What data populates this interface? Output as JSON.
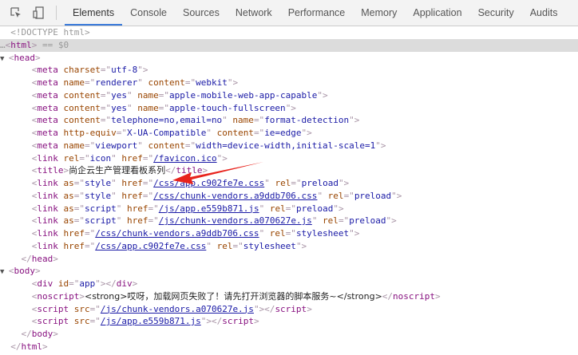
{
  "toolbar": {
    "icons": [
      "inspect-element-icon",
      "device-toggle-icon"
    ],
    "tabs": [
      {
        "label": "Elements",
        "active": true
      },
      {
        "label": "Console"
      },
      {
        "label": "Sources"
      },
      {
        "label": "Network"
      },
      {
        "label": "Performance"
      },
      {
        "label": "Memory"
      },
      {
        "label": "Application"
      },
      {
        "label": "Security"
      },
      {
        "label": "Audits"
      }
    ]
  },
  "colors": {
    "accent": "#3879d9",
    "arrow": "#e8231d",
    "tag": "#881280",
    "attr": "#994500",
    "value": "#1a1aa6"
  },
  "lines": [
    {
      "indent": 1,
      "t": [
        [
          "dim",
          "<!DOCTYPE html>"
        ]
      ]
    },
    {
      "indent": 0,
      "sel": true,
      "t": [
        [
          "dim",
          "…"
        ],
        [
          "br",
          "<"
        ],
        [
          "tag",
          "html"
        ],
        [
          "br",
          ">"
        ],
        [
          "dim",
          " == $0"
        ]
      ]
    },
    {
      "indent": 1,
      "tri": "▼",
      "t": [
        [
          "br",
          "<"
        ],
        [
          "tag",
          "head"
        ],
        [
          "br",
          ">"
        ]
      ]
    },
    {
      "indent": 3,
      "t": [
        [
          "br",
          "<"
        ],
        [
          "tag",
          "meta"
        ],
        [
          "attr",
          " charset"
        ],
        [
          "br",
          "=\""
        ],
        [
          "val",
          "utf-8"
        ],
        [
          "br",
          "\">"
        ]
      ]
    },
    {
      "indent": 3,
      "t": [
        [
          "br",
          "<"
        ],
        [
          "tag",
          "meta"
        ],
        [
          "attr",
          " name"
        ],
        [
          "br",
          "=\""
        ],
        [
          "val",
          "renderer"
        ],
        [
          "br",
          "\""
        ],
        [
          "attr",
          " content"
        ],
        [
          "br",
          "=\""
        ],
        [
          "val",
          "webkit"
        ],
        [
          "br",
          "\">"
        ]
      ]
    },
    {
      "indent": 3,
      "t": [
        [
          "br",
          "<"
        ],
        [
          "tag",
          "meta"
        ],
        [
          "attr",
          " content"
        ],
        [
          "br",
          "=\""
        ],
        [
          "val",
          "yes"
        ],
        [
          "br",
          "\""
        ],
        [
          "attr",
          " name"
        ],
        [
          "br",
          "=\""
        ],
        [
          "val",
          "apple-mobile-web-app-capable"
        ],
        [
          "br",
          "\">"
        ]
      ]
    },
    {
      "indent": 3,
      "t": [
        [
          "br",
          "<"
        ],
        [
          "tag",
          "meta"
        ],
        [
          "attr",
          " content"
        ],
        [
          "br",
          "=\""
        ],
        [
          "val",
          "yes"
        ],
        [
          "br",
          "\""
        ],
        [
          "attr",
          " name"
        ],
        [
          "br",
          "=\""
        ],
        [
          "val",
          "apple-touch-fullscreen"
        ],
        [
          "br",
          "\">"
        ]
      ]
    },
    {
      "indent": 3,
      "t": [
        [
          "br",
          "<"
        ],
        [
          "tag",
          "meta"
        ],
        [
          "attr",
          " content"
        ],
        [
          "br",
          "=\""
        ],
        [
          "val",
          "telephone=no,email=no"
        ],
        [
          "br",
          "\""
        ],
        [
          "attr",
          " name"
        ],
        [
          "br",
          "=\""
        ],
        [
          "val",
          "format-detection"
        ],
        [
          "br",
          "\">"
        ]
      ]
    },
    {
      "indent": 3,
      "t": [
        [
          "br",
          "<"
        ],
        [
          "tag",
          "meta"
        ],
        [
          "attr",
          " http-equiv"
        ],
        [
          "br",
          "=\""
        ],
        [
          "val",
          "X-UA-Compatible"
        ],
        [
          "br",
          "\""
        ],
        [
          "attr",
          " content"
        ],
        [
          "br",
          "=\""
        ],
        [
          "val",
          "ie=edge"
        ],
        [
          "br",
          "\">"
        ]
      ]
    },
    {
      "indent": 3,
      "t": [
        [
          "br",
          "<"
        ],
        [
          "tag",
          "meta"
        ],
        [
          "attr",
          " name"
        ],
        [
          "br",
          "=\""
        ],
        [
          "val",
          "viewport"
        ],
        [
          "br",
          "\""
        ],
        [
          "attr",
          " content"
        ],
        [
          "br",
          "=\""
        ],
        [
          "val",
          "width=device-width,initial-scale=1"
        ],
        [
          "br",
          "\">"
        ]
      ]
    },
    {
      "indent": 3,
      "t": [
        [
          "br",
          "<"
        ],
        [
          "tag",
          "link"
        ],
        [
          "attr",
          " rel"
        ],
        [
          "br",
          "=\""
        ],
        [
          "val",
          "icon"
        ],
        [
          "br",
          "\""
        ],
        [
          "attr",
          " href"
        ],
        [
          "br",
          "=\""
        ],
        [
          "link",
          "/favicon.ico"
        ],
        [
          "br",
          "\">"
        ]
      ]
    },
    {
      "indent": 3,
      "t": [
        [
          "br",
          "<"
        ],
        [
          "tag",
          "title"
        ],
        [
          "br",
          ">"
        ],
        [
          "txt",
          "尚企云生产管理看板系列"
        ],
        [
          "br",
          "</"
        ],
        [
          "tag",
          "title"
        ],
        [
          "br",
          ">"
        ]
      ]
    },
    {
      "indent": 3,
      "t": [
        [
          "br",
          "<"
        ],
        [
          "tag",
          "link"
        ],
        [
          "attr",
          " as"
        ],
        [
          "br",
          "=\""
        ],
        [
          "val",
          "style"
        ],
        [
          "br",
          "\""
        ],
        [
          "attr",
          " href"
        ],
        [
          "br",
          "=\""
        ],
        [
          "link",
          "/css/app.c902fe7e.css"
        ],
        [
          "br",
          "\""
        ],
        [
          "attr",
          " rel"
        ],
        [
          "br",
          "=\""
        ],
        [
          "val",
          "preload"
        ],
        [
          "br",
          "\">"
        ]
      ]
    },
    {
      "indent": 3,
      "t": [
        [
          "br",
          "<"
        ],
        [
          "tag",
          "link"
        ],
        [
          "attr",
          " as"
        ],
        [
          "br",
          "=\""
        ],
        [
          "val",
          "style"
        ],
        [
          "br",
          "\""
        ],
        [
          "attr",
          " href"
        ],
        [
          "br",
          "=\""
        ],
        [
          "link",
          "/css/chunk-vendors.a9ddb706.css"
        ],
        [
          "br",
          "\""
        ],
        [
          "attr",
          " rel"
        ],
        [
          "br",
          "=\""
        ],
        [
          "val",
          "preload"
        ],
        [
          "br",
          "\">"
        ]
      ]
    },
    {
      "indent": 3,
      "t": [
        [
          "br",
          "<"
        ],
        [
          "tag",
          "link"
        ],
        [
          "attr",
          " as"
        ],
        [
          "br",
          "=\""
        ],
        [
          "val",
          "script"
        ],
        [
          "br",
          "\""
        ],
        [
          "attr",
          " href"
        ],
        [
          "br",
          "=\""
        ],
        [
          "link",
          "/js/app.e559b871.js"
        ],
        [
          "br",
          "\""
        ],
        [
          "attr",
          " rel"
        ],
        [
          "br",
          "=\""
        ],
        [
          "val",
          "preload"
        ],
        [
          "br",
          "\">"
        ]
      ]
    },
    {
      "indent": 3,
      "t": [
        [
          "br",
          "<"
        ],
        [
          "tag",
          "link"
        ],
        [
          "attr",
          " as"
        ],
        [
          "br",
          "=\""
        ],
        [
          "val",
          "script"
        ],
        [
          "br",
          "\""
        ],
        [
          "attr",
          " href"
        ],
        [
          "br",
          "=\""
        ],
        [
          "link",
          "/js/chunk-vendors.a070627e.js"
        ],
        [
          "br",
          "\""
        ],
        [
          "attr",
          " rel"
        ],
        [
          "br",
          "=\""
        ],
        [
          "val",
          "preload"
        ],
        [
          "br",
          "\">"
        ]
      ]
    },
    {
      "indent": 3,
      "t": [
        [
          "br",
          "<"
        ],
        [
          "tag",
          "link"
        ],
        [
          "attr",
          " href"
        ],
        [
          "br",
          "=\""
        ],
        [
          "link",
          "/css/chunk-vendors.a9ddb706.css"
        ],
        [
          "br",
          "\""
        ],
        [
          "attr",
          " rel"
        ],
        [
          "br",
          "=\""
        ],
        [
          "val",
          "stylesheet"
        ],
        [
          "br",
          "\">"
        ]
      ]
    },
    {
      "indent": 3,
      "t": [
        [
          "br",
          "<"
        ],
        [
          "tag",
          "link"
        ],
        [
          "attr",
          " href"
        ],
        [
          "br",
          "=\""
        ],
        [
          "link",
          "/css/app.c902fe7e.css"
        ],
        [
          "br",
          "\""
        ],
        [
          "attr",
          " rel"
        ],
        [
          "br",
          "=\""
        ],
        [
          "val",
          "stylesheet"
        ],
        [
          "br",
          "\">"
        ]
      ]
    },
    {
      "indent": 2,
      "t": [
        [
          "br",
          "</"
        ],
        [
          "tag",
          "head"
        ],
        [
          "br",
          ">"
        ]
      ]
    },
    {
      "indent": 1,
      "tri": "▼",
      "t": [
        [
          "br",
          "<"
        ],
        [
          "tag",
          "body"
        ],
        [
          "br",
          ">"
        ]
      ]
    },
    {
      "indent": 3,
      "t": [
        [
          "br",
          "<"
        ],
        [
          "tag",
          "div"
        ],
        [
          "attr",
          " id"
        ],
        [
          "br",
          "=\""
        ],
        [
          "val",
          "app"
        ],
        [
          "br",
          "\"></"
        ],
        [
          "tag",
          "div"
        ],
        [
          "br",
          ">"
        ]
      ]
    },
    {
      "indent": 3,
      "t": [
        [
          "br",
          "<"
        ],
        [
          "tag",
          "noscript"
        ],
        [
          "br",
          ">"
        ],
        [
          "txt",
          "<strong>哎呀，加载网页失败了！请先打开浏览器的脚本服务~</strong>"
        ],
        [
          "br",
          "</"
        ],
        [
          "tag",
          "noscript"
        ],
        [
          "br",
          ">"
        ]
      ]
    },
    {
      "indent": 3,
      "t": [
        [
          "br",
          "<"
        ],
        [
          "tag",
          "script"
        ],
        [
          "attr",
          " src"
        ],
        [
          "br",
          "=\""
        ],
        [
          "link",
          "/js/chunk-vendors.a070627e.js"
        ],
        [
          "br",
          "\"></"
        ],
        [
          "tag",
          "script"
        ],
        [
          "br",
          ">"
        ]
      ]
    },
    {
      "indent": 3,
      "t": [
        [
          "br",
          "<"
        ],
        [
          "tag",
          "script"
        ],
        [
          "attr",
          " src"
        ],
        [
          "br",
          "=\""
        ],
        [
          "link",
          "/js/app.e559b871.js"
        ],
        [
          "br",
          "\"></"
        ],
        [
          "tag",
          "script"
        ],
        [
          "br",
          ">"
        ]
      ]
    },
    {
      "indent": 2,
      "t": [
        [
          "br",
          "</"
        ],
        [
          "tag",
          "body"
        ],
        [
          "br",
          ">"
        ]
      ]
    },
    {
      "indent": 1,
      "t": [
        [
          "br",
          "</"
        ],
        [
          "tag",
          "html"
        ],
        [
          "br",
          ">"
        ]
      ]
    }
  ]
}
